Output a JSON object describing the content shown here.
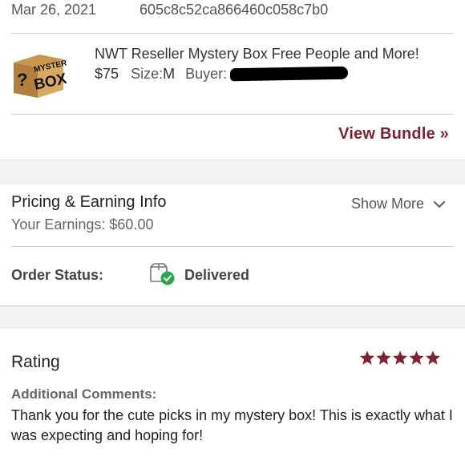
{
  "order": {
    "date": "Mar 26, 2021",
    "order_id": "605c8c52ca866460c058c7b0"
  },
  "item": {
    "image_label_top": "MYSTERY",
    "image_label_bottom": "BOX",
    "image_label_mark": "?",
    "title": "NWT Reseller Mystery Box Free People and More!",
    "price": "$75",
    "size_label": "Size:",
    "size_value": "M",
    "buyer_label": "Buyer:"
  },
  "bundle": {
    "link_label": "View Bundle »"
  },
  "pricing": {
    "title": "Pricing & Earning Info",
    "earnings": "Your Earnings: $60.00",
    "show_more": "Show More"
  },
  "status": {
    "label": "Order Status:",
    "value": "Delivered",
    "icon": "delivered-box-check-icon",
    "icon_color": "#2aa84a"
  },
  "rating": {
    "label": "Rating",
    "stars": 5,
    "star_color": "#7f2332",
    "comments_label": "Additional Comments:",
    "comment": "Thank you for the cute picks in my mystery box! This is exactly what I was expecting and hoping for!"
  },
  "colors": {
    "accent": "#7f2332",
    "band": "#f4f2f1",
    "divider": "#cfcfcf"
  }
}
